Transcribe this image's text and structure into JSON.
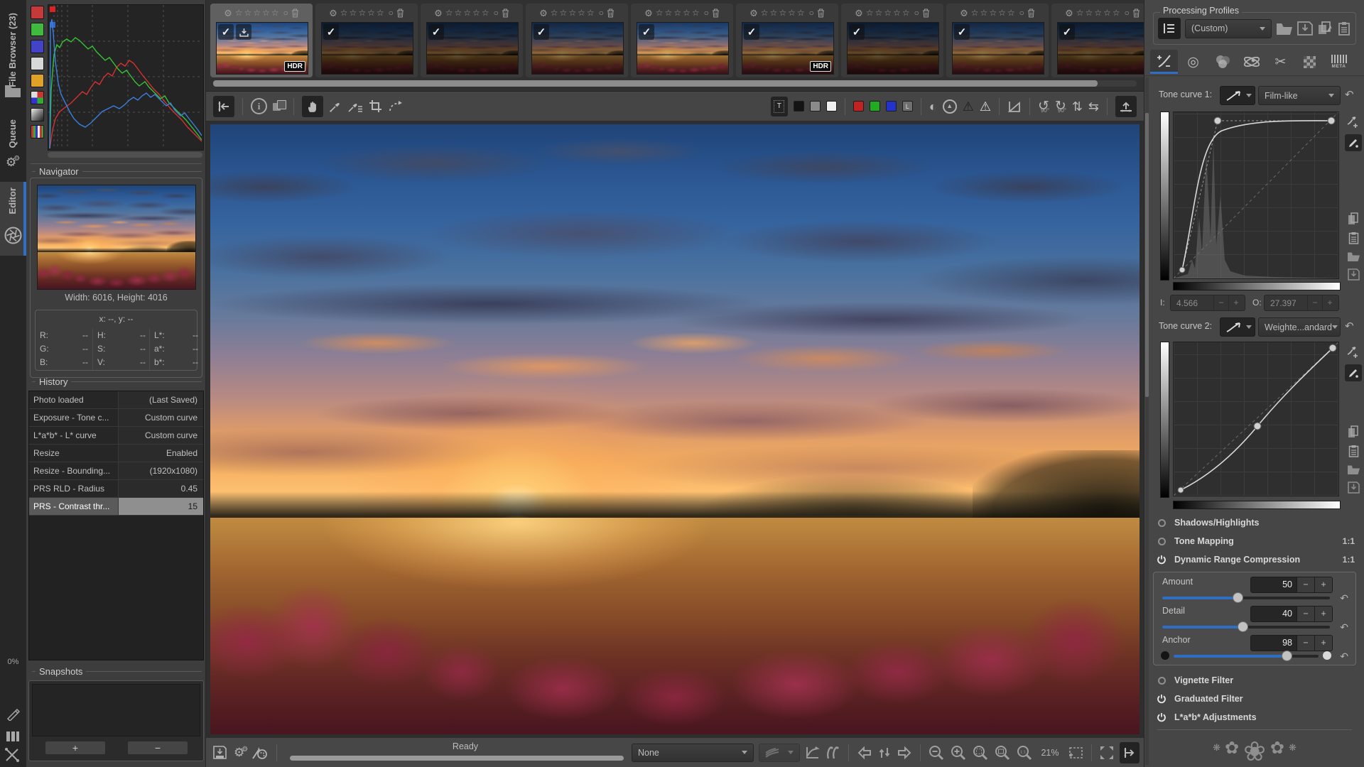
{
  "left_tabs": {
    "file_browser": "File Browser (23)",
    "queue": "Queue",
    "editor": "Editor",
    "battery": "0%"
  },
  "navigator": {
    "title": "Navigator",
    "size_label": "Width: 6016, Height: 4016",
    "xy_label": "x: --, y: --",
    "cols": [
      [
        {
          "l": "R:",
          "v": "--"
        },
        {
          "l": "G:",
          "v": "--"
        },
        {
          "l": "B:",
          "v": "--"
        }
      ],
      [
        {
          "l": "H:",
          "v": "--"
        },
        {
          "l": "S:",
          "v": "--"
        },
        {
          "l": "V:",
          "v": "--"
        }
      ],
      [
        {
          "l": "L*:",
          "v": "--"
        },
        {
          "l": "a*:",
          "v": "--"
        },
        {
          "l": "b*:",
          "v": "--"
        }
      ]
    ]
  },
  "history": {
    "title": "History",
    "rows": [
      {
        "name": "Photo loaded",
        "value": "(Last Saved)"
      },
      {
        "name": "Exposure - Tone c...",
        "value": "Custom curve"
      },
      {
        "name": "L*a*b* - L* curve",
        "value": "Custom curve"
      },
      {
        "name": "Resize",
        "value": "Enabled"
      },
      {
        "name": "Resize - Bounding...",
        "value": "(1920x1080)"
      },
      {
        "name": "PRS RLD - Radius",
        "value": "0.45"
      },
      {
        "name": "PRS - Contrast thr...",
        "value": "15"
      }
    ],
    "selected_index": 6
  },
  "snapshots": {
    "title": "Snapshots",
    "add": "+",
    "remove": "−"
  },
  "filmstrip": {
    "hdr_badge": "HDR",
    "items": [
      {
        "selected": true,
        "saved": true,
        "hdr": true,
        "variant": "v1"
      },
      {
        "variant": "v2"
      },
      {
        "variant": "v2"
      },
      {
        "variant": "v3"
      },
      {
        "variant": "v4"
      },
      {
        "hdr": true,
        "variant": "v3"
      },
      {
        "variant": "v2"
      },
      {
        "variant": "v3"
      },
      {
        "variant": "v2"
      },
      {
        "variant": "v2"
      }
    ]
  },
  "glyphs": {
    "star": "☆",
    "gear": "⚙",
    "circle_o": "○",
    "check": "✓",
    "half_circle": "◐",
    "warning": "⚠",
    "rotate_ccw": "↺",
    "rotate_cw": "↻",
    "flip_v": "⇅",
    "flip_h": "⇆",
    "undo": "↶",
    "deg90": "90°",
    "triangle": "▲",
    "target": "◎",
    "scissors": "✂",
    "flower_small": "❋",
    "flower_mid": "✿",
    "flower_big": "❀"
  },
  "toolbar": {
    "bg_label": "T",
    "channel_l": "L",
    "info": "i"
  },
  "statusbar": {
    "ready": "Ready",
    "profile_value": "None",
    "zoom_value": "21%"
  },
  "right_panel": {
    "profiles_title": "Processing Profiles",
    "profile_value": "(Custom)",
    "meta_tab": "META",
    "tone_curve_1_label": "Tone curve 1:",
    "tone_curve_1_mode": "Film-like",
    "io": {
      "i_label": "I:",
      "i_value": "4.566",
      "o_label": "O:",
      "o_value": "27.397",
      "minus": "−",
      "plus": "+"
    },
    "tone_curve_2_label": "Tone curve 2:",
    "tone_curve_2_mode": "Weighte...andard",
    "sections": [
      {
        "label": "Shadows/Highlights",
        "enabled": false,
        "badge": ""
      },
      {
        "label": "Tone Mapping",
        "enabled": false,
        "badge": "1:1"
      },
      {
        "label": "Dynamic Range Compression",
        "enabled": true,
        "badge": "1:1"
      }
    ],
    "drc_sliders": [
      {
        "label": "Amount",
        "value": "50",
        "pct": 45,
        "endpoints": false
      },
      {
        "label": "Detail",
        "value": "40",
        "pct": 48,
        "endpoints": false
      },
      {
        "label": "Anchor",
        "value": "98",
        "pct": 78,
        "endpoints": true
      }
    ],
    "bottom_sections": [
      {
        "label": "Vignette Filter",
        "enabled": false
      },
      {
        "label": "Graduated Filter",
        "enabled": true
      },
      {
        "label": "L*a*b* Adjustments",
        "enabled": true
      }
    ]
  }
}
